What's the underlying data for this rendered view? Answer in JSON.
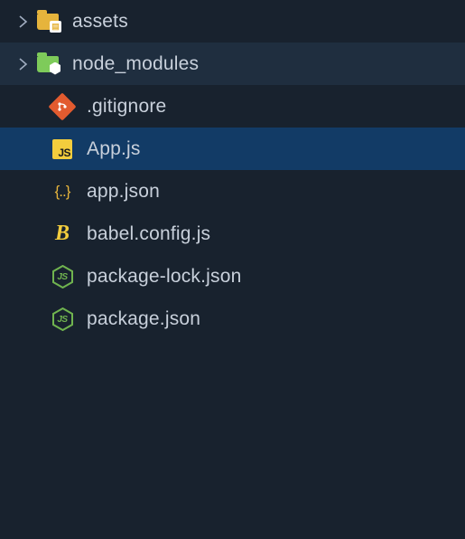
{
  "explorer": {
    "items": [
      {
        "type": "folder",
        "name": "assets",
        "expanded": false,
        "icon": "folder-assets",
        "state": ""
      },
      {
        "type": "folder",
        "name": "node_modules",
        "expanded": false,
        "icon": "folder-node-modules",
        "state": "hovered"
      },
      {
        "type": "file",
        "name": ".gitignore",
        "icon": "git-icon",
        "state": ""
      },
      {
        "type": "file",
        "name": "App.js",
        "icon": "js-icon",
        "state": "selected"
      },
      {
        "type": "file",
        "name": "app.json",
        "icon": "json-icon",
        "state": ""
      },
      {
        "type": "file",
        "name": "babel.config.js",
        "icon": "babel-icon",
        "state": ""
      },
      {
        "type": "file",
        "name": "package-lock.json",
        "icon": "node-json-icon",
        "state": ""
      },
      {
        "type": "file",
        "name": "package.json",
        "icon": "node-json-icon",
        "state": ""
      }
    ],
    "icon_labels": {
      "json_braces": "{..}",
      "babel_letter": "B",
      "node_letters": "JS",
      "js_letters": "JS",
      "assets_badge": "▤"
    }
  },
  "colors": {
    "background": "#18222e",
    "selected": "#123b66",
    "hovered": "#1f2e3f",
    "text": "#c8d0db",
    "assets_folder": "#e6b43c",
    "node_folder": "#7ecb5a",
    "git": "#e25b2f",
    "js": "#f3cd3d",
    "babel": "#f3cd3d",
    "node": "#70b44f"
  }
}
